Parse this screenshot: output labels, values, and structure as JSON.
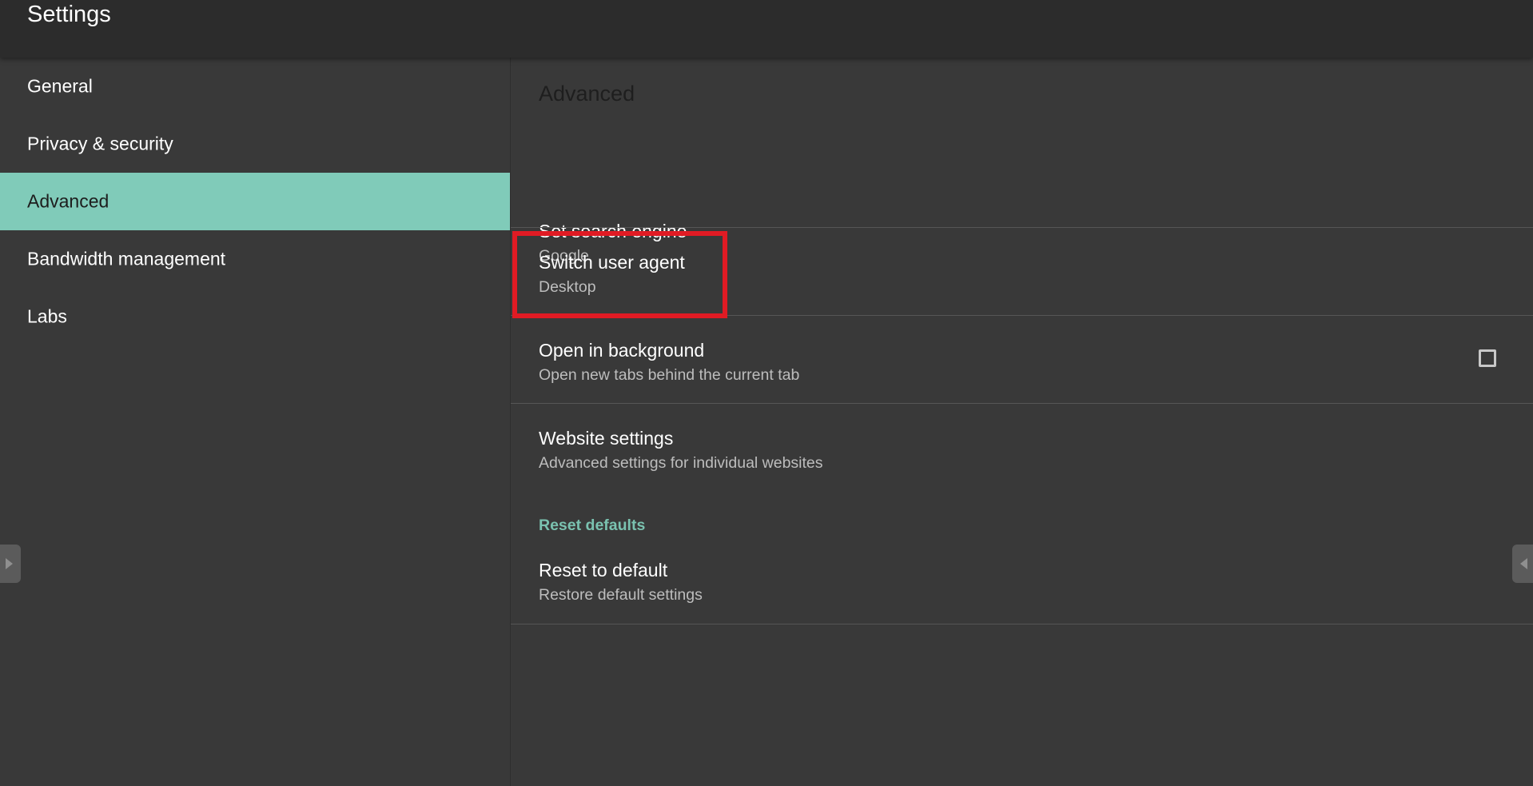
{
  "appbar": {
    "title": "Settings"
  },
  "sidebar": {
    "items": [
      {
        "label": "General"
      },
      {
        "label": "Privacy & security"
      },
      {
        "label": "Advanced",
        "active": true
      },
      {
        "label": "Bandwidth management"
      },
      {
        "label": "Labs"
      }
    ]
  },
  "content": {
    "heading": "Advanced",
    "preferences": [
      {
        "title": "Set search engine",
        "summary": "Google"
      },
      {
        "title": "Switch user agent",
        "summary": "Desktop"
      },
      {
        "title": "Open in background",
        "summary": "Open new tabs behind the current tab",
        "checked": false
      },
      {
        "title": "Website settings",
        "summary": "Advanced settings for individual websites"
      }
    ],
    "reset_category": "Reset defaults",
    "reset": {
      "title": "Reset to default",
      "summary": "Restore default settings"
    }
  },
  "colors": {
    "accent": "#80cbb9",
    "category_text": "#7ac2b0",
    "highlight": "#e01b24",
    "background": "#393939",
    "appbar": "#2c2c2c"
  },
  "icons": {
    "left_edge": "chevron-right-icon",
    "right_edge": "chevron-left-icon"
  }
}
